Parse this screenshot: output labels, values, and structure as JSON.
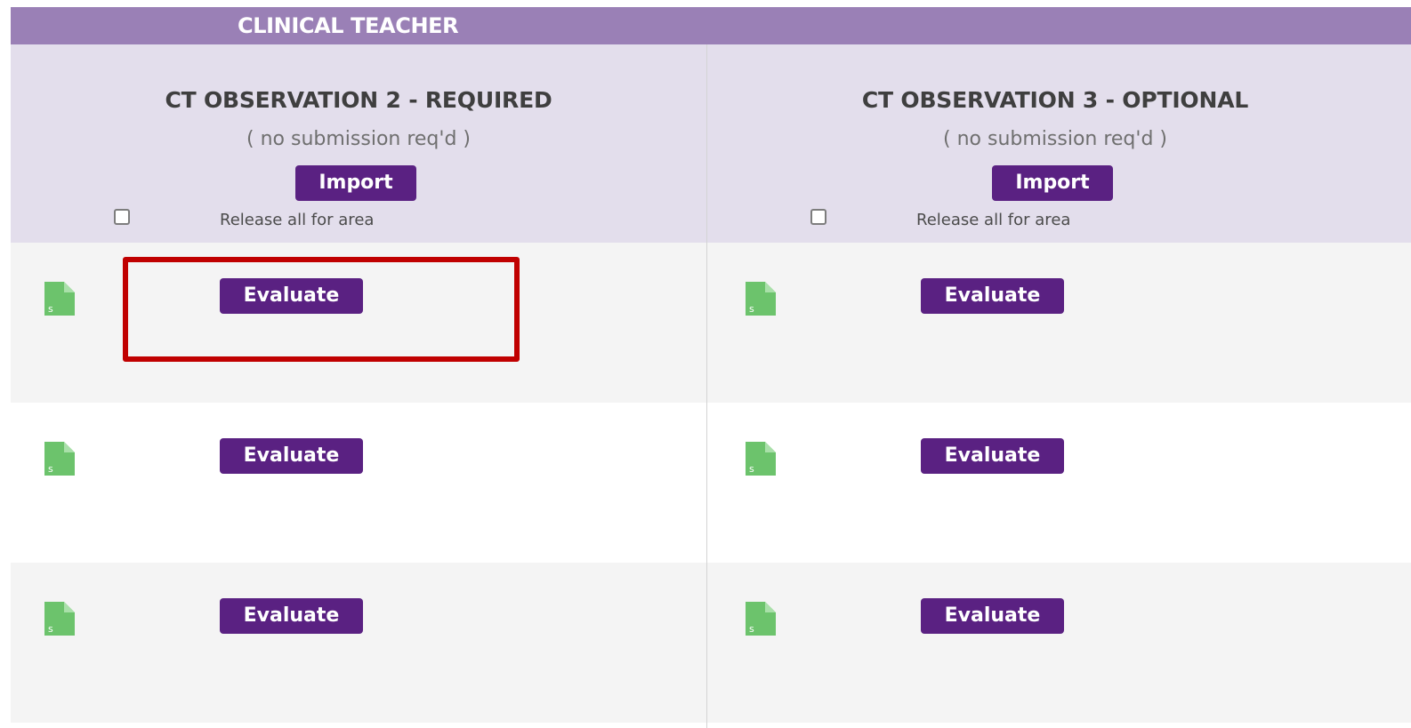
{
  "section": {
    "title": "CLINICAL TEACHER",
    "bar_color": "#9a80b6"
  },
  "columns": [
    {
      "title": "CT OBSERVATION 2 - REQUIRED",
      "subtitle": "( no submission req'd )",
      "import_label": "Import",
      "release_label": "Release all for area",
      "release_checked": false
    },
    {
      "title": "CT OBSERVATION 3 - OPTIONAL",
      "subtitle": "( no submission req'd )",
      "import_label": "Import",
      "release_label": "Release all for area",
      "release_checked": false
    }
  ],
  "rows": [
    {
      "cells": [
        {
          "icon": "file-icon",
          "icon_label": "s",
          "evaluate_label": "Evaluate"
        },
        {
          "icon": "file-icon",
          "icon_label": "s",
          "evaluate_label": "Evaluate"
        }
      ]
    },
    {
      "cells": [
        {
          "icon": "file-icon",
          "icon_label": "s",
          "evaluate_label": "Evaluate"
        },
        {
          "icon": "file-icon",
          "icon_label": "s",
          "evaluate_label": "Evaluate"
        }
      ]
    },
    {
      "cells": [
        {
          "icon": "file-icon",
          "icon_label": "s",
          "evaluate_label": "Evaluate"
        },
        {
          "icon": "file-icon",
          "icon_label": "s",
          "evaluate_label": "Evaluate"
        }
      ]
    }
  ],
  "colors": {
    "header_bg": "#e3deec",
    "button_bg": "#5a2182",
    "file_icon": "#6cc36c",
    "highlight": "#c00000",
    "row_alt": "#f4f4f4"
  }
}
